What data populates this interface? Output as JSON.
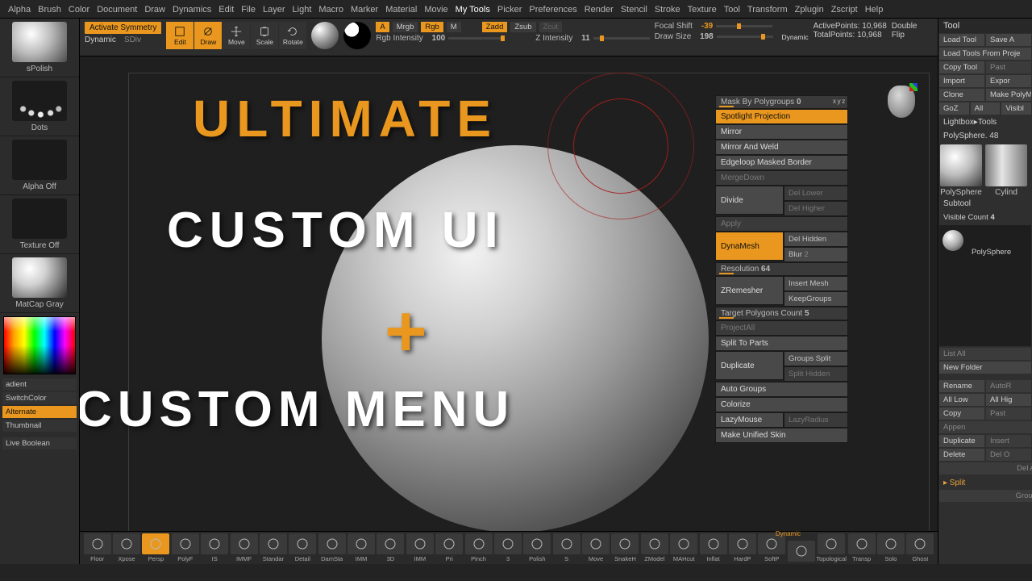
{
  "menu": {
    "items": [
      "Alpha",
      "Brush",
      "Color",
      "Document",
      "Draw",
      "Dynamics",
      "Edit",
      "File",
      "Layer",
      "Light",
      "Macro",
      "Marker",
      "Material",
      "Movie",
      "My Tools",
      "Picker",
      "Preferences",
      "Render",
      "Stencil",
      "Stroke",
      "Texture",
      "Tool",
      "Transform",
      "Zplugin",
      "Zscript",
      "Help"
    ],
    "active": "My Tools"
  },
  "left": {
    "brush": "sPolish",
    "stroke": "Dots",
    "alpha": "Alpha Off",
    "texture": "Texture Off",
    "material": "MatCap Gray",
    "gradient": "adient",
    "switch": "SwitchColor",
    "alternate": "Alternate",
    "thumbnail": "Thumbnail",
    "boolean": "Live Boolean"
  },
  "toolbar": {
    "activate": "Activate Symmetry",
    "dynamic": "Dynamic",
    "sdiv": "SDiv",
    "modes": [
      {
        "l": "Edit",
        "on": true
      },
      {
        "l": "Draw",
        "on": true
      },
      {
        "l": "Move",
        "on": false
      },
      {
        "l": "Scale",
        "on": false
      },
      {
        "l": "Rotate",
        "on": false
      }
    ],
    "A": "A",
    "mrgb": "Mrgb",
    "rgb": "Rgb",
    "M": "M",
    "zadd": "Zadd",
    "zsub": "Zsub",
    "zcut": "Zcut",
    "rgbInt": {
      "l": "Rgb Intensity",
      "v": "100"
    },
    "zInt": {
      "l": "Z Intensity",
      "v": "11"
    },
    "focal": {
      "l": "Focal Shift",
      "v": "-39"
    },
    "drawSize": {
      "l": "Draw Size",
      "v": "198"
    },
    "dyn2": "Dynamic",
    "activePts": {
      "l": "ActivePoints:",
      "v": "10,968"
    },
    "totalPts": {
      "l": "TotalPoints:",
      "v": "10,968"
    },
    "double": "Double",
    "flip": "Flip"
  },
  "float": {
    "mask": {
      "l": "Mask By Polygroups",
      "v": "0"
    },
    "spotlight": "Spotlight Projection",
    "mirror": "Mirror",
    "mirrorWeld": "Mirror And Weld",
    "edgeloop": "Edgeloop Masked Border",
    "mergeDown": "MergeDown",
    "divide": "Divide",
    "delLower": "Del Lower",
    "delHigher": "Del Higher",
    "apply": "Apply",
    "dynamesh": "DynaMesh",
    "delHidden": "Del Hidden",
    "blur": "Blur",
    "resolution": {
      "l": "Resolution",
      "v": "64"
    },
    "zremesher": "ZRemesher",
    "insertMesh": "Insert Mesh",
    "keepGroups": "KeepGroups",
    "target": {
      "l": "Target Polygons Count",
      "v": "5"
    },
    "projectAll": "ProjectAll",
    "splitParts": "Split To Parts",
    "duplicate": "Duplicate",
    "groupsSplit": "Groups Split",
    "splitHidden": "Split Hidden",
    "autoGroups": "Auto Groups",
    "colorize": "Colorize",
    "lazyMouse": "LazyMouse",
    "lazyRadius": "LazyRadius",
    "unified": "Make Unified Skin"
  },
  "overlay": {
    "t1": "ULTIMATE",
    "t2": "CUSTOM UI",
    "plus": "+",
    "t3": "CUSTOM MENU"
  },
  "bottom": {
    "items": [
      "Floor",
      "Xpose",
      "Persp",
      "PolyF",
      "IS",
      "IMMF",
      "Standar",
      "Detail",
      "DamSta",
      "IMM",
      "3D",
      "IMM",
      "Pri",
      "Pinch",
      "3",
      "Polish",
      "S",
      "Move",
      "SnakeH",
      "ZModel",
      "MAHcut",
      "Inflat",
      "HardP",
      "SoftP",
      "",
      "Topological",
      "Transp",
      "Solo",
      "Ghost"
    ],
    "dyn": "Dynamic"
  },
  "right": {
    "title": "Tool",
    "loadTool": "Load Tool",
    "saveAs": "Save A",
    "loadProj": "Load Tools From Proje",
    "copyTool": "Copy Tool",
    "paste": "Past",
    "import": "Import",
    "export": "Expor",
    "clone": "Clone",
    "makePoly": "Make PolyMes",
    "goz": "GoZ",
    "all": "All",
    "visible": "Visibl",
    "lightbox": "Lightbox▸Tools",
    "polysphere": "PolySphere.",
    "polyId": "48",
    "th1": "PolySphere",
    "th2": "PolyS",
    "cyl": "Cylind",
    "subtool": "Subtool",
    "visCount": {
      "l": "Visible Count",
      "v": "4"
    },
    "stName": "PolySphere",
    "listAll": "List All",
    "newFolder": "New Folder",
    "rename": "Rename",
    "autoR": "AutoR",
    "allLow": "All Low",
    "allHigh": "All Hig",
    "copy": "Copy",
    "paste2": "Past",
    "appen": "Appen",
    "dup": "Duplicate",
    "insert": "Insert",
    "delete": "Delete",
    "delO": "Del O",
    "delAll": "Del Al",
    "split": "▸ Split",
    "group": "Group"
  }
}
